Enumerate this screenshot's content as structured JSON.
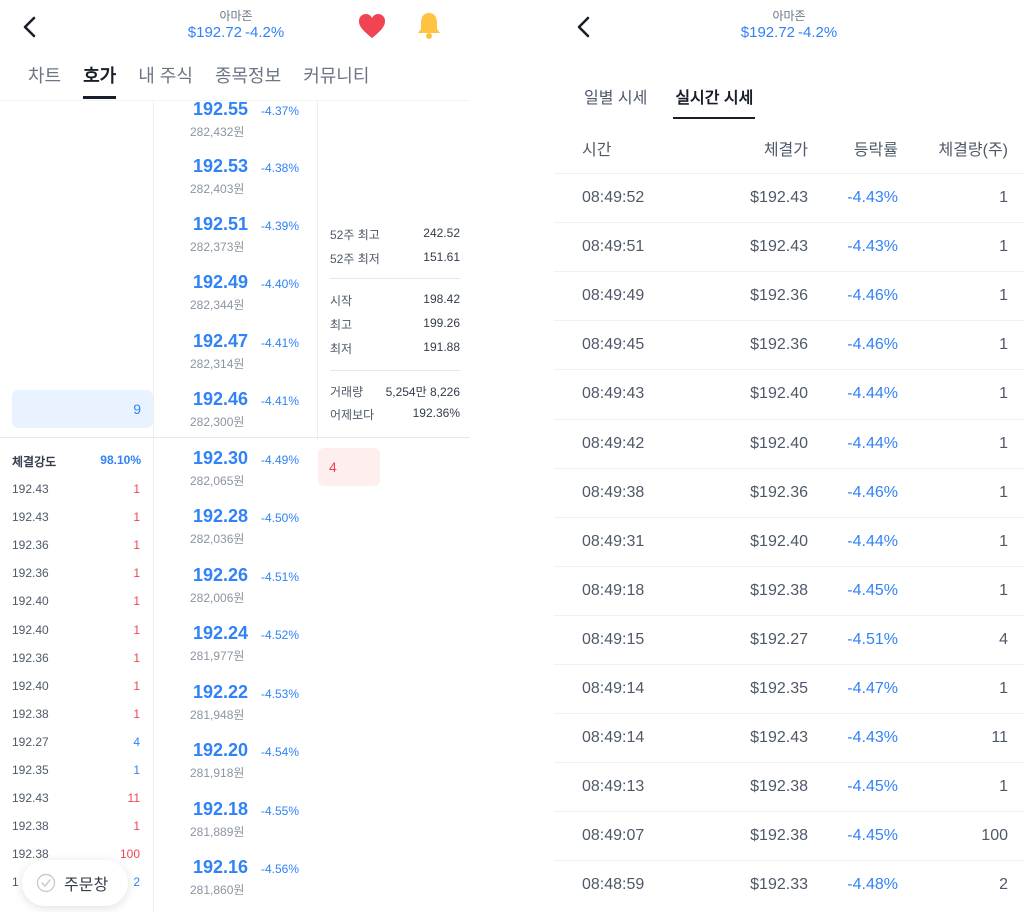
{
  "left": {
    "header": {
      "name": "아마존",
      "price": "$192.72",
      "change": "-4.2%"
    },
    "tabs": [
      {
        "label": "차트",
        "active": false
      },
      {
        "label": "호가",
        "active": true
      },
      {
        "label": "내 주식",
        "active": false
      },
      {
        "label": "종목정보",
        "active": false
      },
      {
        "label": "커뮤니티",
        "active": false
      }
    ],
    "orderbook": [
      {
        "price": "192.55",
        "pct": "-4.37%",
        "krw": "282,432원"
      },
      {
        "price": "192.53",
        "pct": "-4.38%",
        "krw": "282,403원"
      },
      {
        "price": "192.51",
        "pct": "-4.39%",
        "krw": "282,373원"
      },
      {
        "price": "192.49",
        "pct": "-4.40%",
        "krw": "282,344원"
      },
      {
        "price": "192.47",
        "pct": "-4.41%",
        "krw": "282,314원"
      },
      {
        "price": "192.46",
        "pct": "-4.41%",
        "krw": "282,300원"
      },
      {
        "price": "192.30",
        "pct": "-4.49%",
        "krw": "282,065원"
      },
      {
        "price": "192.28",
        "pct": "-4.50%",
        "krw": "282,036원"
      },
      {
        "price": "192.26",
        "pct": "-4.51%",
        "krw": "282,006원"
      },
      {
        "price": "192.24",
        "pct": "-4.52%",
        "krw": "281,977원"
      },
      {
        "price": "192.22",
        "pct": "-4.53%",
        "krw": "281,948원"
      },
      {
        "price": "192.20",
        "pct": "-4.54%",
        "krw": "281,918원"
      },
      {
        "price": "192.18",
        "pct": "-4.55%",
        "krw": "281,889원"
      },
      {
        "price": "192.16",
        "pct": "-4.56%",
        "krw": "281,860원"
      }
    ],
    "stats": [
      {
        "label": "52주 최고",
        "value": "242.52",
        "color": ""
      },
      {
        "label": "52주 최저",
        "value": "151.61",
        "color": ""
      },
      {
        "label": "시작",
        "value": "198.42",
        "color": ""
      },
      {
        "label": "최고",
        "value": "199.26",
        "color": "red"
      },
      {
        "label": "최저",
        "value": "191.88",
        "color": "blue"
      },
      {
        "label": "거래량",
        "value": "5,254만 8,226",
        "color": ""
      },
      {
        "label": "어제보다",
        "value": "192.36%",
        "color": ""
      }
    ],
    "buy_volume": "9",
    "sell_volume": "4",
    "strength": {
      "label": "체결강도",
      "value": "98.10%"
    },
    "executions": [
      {
        "price": "192.43",
        "qty": "1",
        "color": "red"
      },
      {
        "price": "192.43",
        "qty": "1",
        "color": "red"
      },
      {
        "price": "192.36",
        "qty": "1",
        "color": "red"
      },
      {
        "price": "192.36",
        "qty": "1",
        "color": "red"
      },
      {
        "price": "192.40",
        "qty": "1",
        "color": "red"
      },
      {
        "price": "192.40",
        "qty": "1",
        "color": "red"
      },
      {
        "price": "192.36",
        "qty": "1",
        "color": "red"
      },
      {
        "price": "192.40",
        "qty": "1",
        "color": "red"
      },
      {
        "price": "192.38",
        "qty": "1",
        "color": "red"
      },
      {
        "price": "192.27",
        "qty": "4",
        "color": "blue"
      },
      {
        "price": "192.35",
        "qty": "1",
        "color": "blue"
      },
      {
        "price": "192.43",
        "qty": "11",
        "color": "red"
      },
      {
        "price": "192.38",
        "qty": "1",
        "color": "red"
      },
      {
        "price": "192.38",
        "qty": "100",
        "color": "red"
      },
      {
        "price": "1",
        "qty": "2",
        "color": "blue"
      }
    ],
    "order_button": "주문창"
  },
  "right": {
    "header": {
      "name": "아마존",
      "price": "$192.72",
      "change": "-4.2%"
    },
    "tabs": [
      {
        "label": "일별 시세",
        "active": false
      },
      {
        "label": "실시간 시세",
        "active": true
      }
    ],
    "columns": {
      "time": "시간",
      "price": "체결가",
      "rate": "등락률",
      "volume": "체결량(주)"
    },
    "rows": [
      {
        "time": "08:49:52",
        "price": "$192.43",
        "rate": "-4.43%",
        "volume": "1"
      },
      {
        "time": "08:49:51",
        "price": "$192.43",
        "rate": "-4.43%",
        "volume": "1"
      },
      {
        "time": "08:49:49",
        "price": "$192.36",
        "rate": "-4.46%",
        "volume": "1"
      },
      {
        "time": "08:49:45",
        "price": "$192.36",
        "rate": "-4.46%",
        "volume": "1"
      },
      {
        "time": "08:49:43",
        "price": "$192.40",
        "rate": "-4.44%",
        "volume": "1"
      },
      {
        "time": "08:49:42",
        "price": "$192.40",
        "rate": "-4.44%",
        "volume": "1"
      },
      {
        "time": "08:49:38",
        "price": "$192.36",
        "rate": "-4.46%",
        "volume": "1"
      },
      {
        "time": "08:49:31",
        "price": "$192.40",
        "rate": "-4.44%",
        "volume": "1"
      },
      {
        "time": "08:49:18",
        "price": "$192.38",
        "rate": "-4.45%",
        "volume": "1"
      },
      {
        "time": "08:49:15",
        "price": "$192.27",
        "rate": "-4.51%",
        "volume": "4"
      },
      {
        "time": "08:49:14",
        "price": "$192.35",
        "rate": "-4.47%",
        "volume": "1"
      },
      {
        "time": "08:49:14",
        "price": "$192.43",
        "rate": "-4.43%",
        "volume": "11"
      },
      {
        "time": "08:49:13",
        "price": "$192.38",
        "rate": "-4.45%",
        "volume": "1"
      },
      {
        "time": "08:49:07",
        "price": "$192.38",
        "rate": "-4.45%",
        "volume": "100"
      },
      {
        "time": "08:48:59",
        "price": "$192.33",
        "rate": "-4.48%",
        "volume": "2"
      }
    ]
  },
  "colors": {
    "blue": "#3182f6",
    "red": "#f04452",
    "heart": "#f04452",
    "bell": "#ffc342"
  },
  "icons": [
    "back-arrow-icon",
    "heart-icon",
    "bell-icon",
    "check-circle-icon"
  ]
}
